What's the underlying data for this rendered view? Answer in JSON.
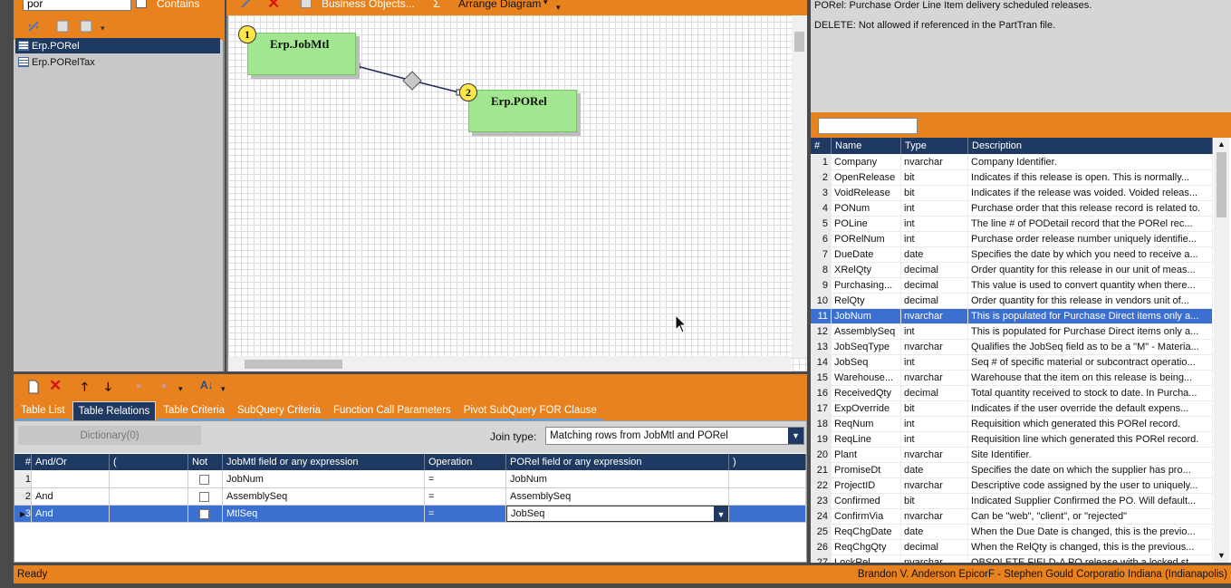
{
  "search": {
    "value": "por",
    "contains_label": "Contains"
  },
  "table_list": [
    {
      "name": "Erp.PORel",
      "selected": true
    },
    {
      "name": "Erp.PORelTax",
      "selected": false
    }
  ],
  "diagram_toolbar": {
    "business_objects": "Business Objects...",
    "sigma": "Σ",
    "arrange": "Arrange Diagram"
  },
  "diagram": {
    "entities": [
      {
        "num": "1",
        "name": "Erp.JobMtl"
      },
      {
        "num": "2",
        "name": "Erp.PORel"
      }
    ]
  },
  "tabs": [
    {
      "label": "Table List",
      "active": false
    },
    {
      "label": "Table Relations",
      "active": true
    },
    {
      "label": "Table Criteria",
      "active": false
    },
    {
      "label": "SubQuery Criteria",
      "active": false
    },
    {
      "label": "Function Call Parameters",
      "active": false
    },
    {
      "label": "Pivot SubQuery FOR Clause",
      "active": false
    }
  ],
  "relations": {
    "dictionary_label": "Dictionary(0)",
    "join_label": "Join type:",
    "join_value": "Matching rows from JobMtl and PORel",
    "columns": [
      "#",
      "And/Or",
      "(",
      "Not",
      "JobMtl field or any expression",
      "Operation",
      "PORel field or any expression",
      ")"
    ],
    "rows": [
      {
        "num": "1",
        "andor": "",
        "open": "",
        "left": "JobNum",
        "op": "=",
        "right": "JobNum",
        "close": ""
      },
      {
        "num": "2",
        "andor": "And",
        "open": "",
        "left": "AssemblySeq",
        "op": "=",
        "right": "AssemblySeq",
        "close": ""
      },
      {
        "num": "3",
        "andor": "And",
        "open": "",
        "left": "MtlSeq",
        "op": "=",
        "right": "JobSeq",
        "close": "",
        "selected": true
      }
    ]
  },
  "right_info": {
    "line1": "PORel: Purchase Order Line Item delivery scheduled releases.",
    "line2": "DELETE: Not allowed if referenced in the PartTran file."
  },
  "fields_head": [
    "#",
    "Name",
    "Type",
    "Description"
  ],
  "fields": [
    [
      "1",
      "Company",
      "nvarchar",
      "Company Identifier."
    ],
    [
      "2",
      "OpenRelease",
      "bit",
      "Indicates if this release is open.  This is normally..."
    ],
    [
      "3",
      "VoidRelease",
      "bit",
      "Indicates if the release was voided. Voided releas..."
    ],
    [
      "4",
      "PONum",
      "int",
      "Purchase order that this release record is related to."
    ],
    [
      "5",
      "POLine",
      "int",
      "The line # of  PODetail record that the PORel rec..."
    ],
    [
      "6",
      "PORelNum",
      "int",
      "Purchase order release number uniquely identifie..."
    ],
    [
      "7",
      "DueDate",
      "date",
      "Specifies the date by which you need to receive a..."
    ],
    [
      "8",
      "XRelQty",
      "decimal",
      "Order quantity for this release in our unit of meas..."
    ],
    [
      "9",
      "Purchasing...",
      "decimal",
      "This value is used to convert quantity when there..."
    ],
    [
      "10",
      "RelQty",
      "decimal",
      "Order quantity for this release in vendors unit of..."
    ],
    [
      "11",
      "JobNum",
      "nvarchar",
      "This is populated for Purchase Direct items only a..."
    ],
    [
      "12",
      "AssemblySeq",
      "int",
      "This is populated for Purchase Direct items only a..."
    ],
    [
      "13",
      "JobSeqType",
      "nvarchar",
      "Qualifies the JobSeq field as to be a \"M\" - Materia..."
    ],
    [
      "14",
      "JobSeq",
      "int",
      "Seq # of specific material or subcontract operatio..."
    ],
    [
      "15",
      "Warehouse...",
      "nvarchar",
      "Warehouse that the item on this release is being..."
    ],
    [
      "16",
      "ReceivedQty",
      "decimal",
      "Total quantity received to stock to date. In Purcha..."
    ],
    [
      "17",
      "ExpOverride",
      "bit",
      "Indicates if the user override the default  expens..."
    ],
    [
      "18",
      "ReqNum",
      "int",
      "Requisition which generated this PORel record."
    ],
    [
      "19",
      "ReqLine",
      "int",
      "Requisition line which generated this PORel record."
    ],
    [
      "20",
      "Plant",
      "nvarchar",
      "Site Identifier."
    ],
    [
      "21",
      "PromiseDt",
      "date",
      "  Specifies the date on which the supplier has pro..."
    ],
    [
      "22",
      "ProjectID",
      "nvarchar",
      "Descriptive code assigned by the user to uniquely..."
    ],
    [
      "23",
      "Confirmed",
      "bit",
      "Indicated Supplier Confirmed the PO.  Will default..."
    ],
    [
      "24",
      "ConfirmVia",
      "nvarchar",
      "Can be \"web\", \"client\", or \"rejected\""
    ],
    [
      "25",
      "ReqChgDate",
      "date",
      "When the Due Date is changed, this is the previo..."
    ],
    [
      "26",
      "ReqChgQty",
      "decimal",
      "When the RelQty is changed, this is the previous..."
    ],
    [
      "27",
      "LockRel",
      "nvarchar",
      "OBSOLETE FIELD-A PO release with a locked st..."
    ]
  ],
  "selected_field_index": 10,
  "status": {
    "left": "Ready",
    "right": "Brandon V. Anderson  EpicorF - Stephen Gould Corporatio  Indiana (Indianapolis)"
  },
  "colors": {
    "accent": "#e8821e",
    "header": "#1f3a62",
    "selection": "#3b6fd0",
    "entity": "#a1e790"
  }
}
